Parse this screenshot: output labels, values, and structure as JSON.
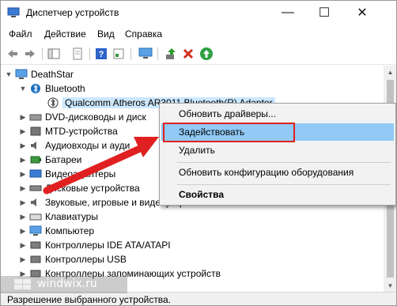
{
  "window": {
    "title": "Диспетчер устройств"
  },
  "controls": {
    "minimize": "—",
    "maximize": "☐",
    "close": "✕"
  },
  "menu": [
    "Файл",
    "Действие",
    "Вид",
    "Справка"
  ],
  "tree": {
    "root": "DeathStar",
    "items": [
      {
        "label": "Bluetooth",
        "expanded": true
      },
      {
        "label": "Qualcomm Atheros AR3011 Bluetooth(R) Adapter",
        "selected": true
      },
      {
        "label": "DVD-дисководы и диск"
      },
      {
        "label": "MTD-устройства"
      },
      {
        "label": "Аудиовходы и ауди"
      },
      {
        "label": "Батареи"
      },
      {
        "label": "Видеоадаптеры"
      },
      {
        "label": "Дисковые устройства"
      },
      {
        "label": "Звуковые, игровые и видеоустройства"
      },
      {
        "label": "Клавиатуры"
      },
      {
        "label": "Компьютер"
      },
      {
        "label": "Контроллеры IDE ATA/ATAPI"
      },
      {
        "label": "Контроллеры USB"
      },
      {
        "label": "Контроллеры запоминающих устройств"
      }
    ]
  },
  "context_menu": {
    "items": [
      "Обновить драйверы...",
      "Задействовать",
      "Удалить",
      "Обновить конфигурацию оборудования",
      "Свойства"
    ],
    "highlighted": "Задействовать"
  },
  "status": {
    "text": "Разрешение выбранного устройства."
  },
  "watermark": {
    "text": "windwix.ru"
  },
  "colors": {
    "highlight": "#91c9f7",
    "selection": "#cce8ff",
    "annotation": "#e02020"
  }
}
